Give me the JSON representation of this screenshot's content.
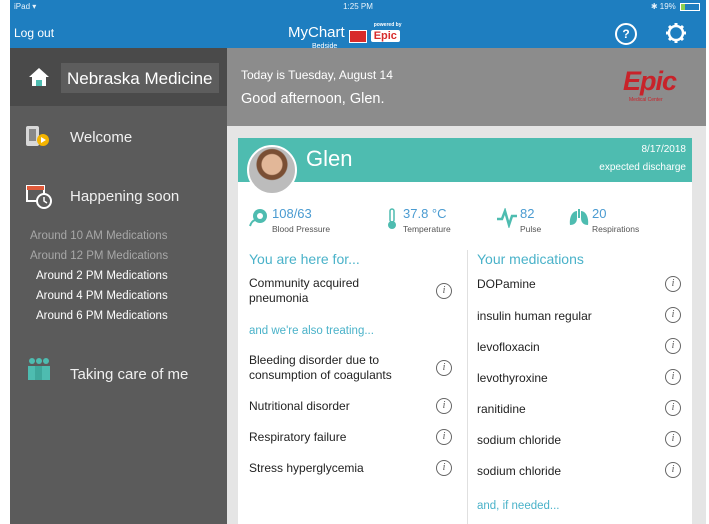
{
  "status_bar": {
    "carrier": "iPad",
    "time": "1:25 PM",
    "battery": "19%"
  },
  "header": {
    "logout_label": "Log out",
    "logo_main": "MyChart",
    "logo_sub": "Bedside",
    "logo_powered": "powered by",
    "logo_epic": "Epic",
    "help_label": "?"
  },
  "sidebar": {
    "org_name": "Nebraska Medicine",
    "welcome": "Welcome",
    "happening_soon": "Happening soon",
    "schedule": [
      {
        "time": "Around 10 AM",
        "item": "Medications"
      },
      {
        "time": "Around 12 PM",
        "item": "Medications"
      },
      {
        "time": "Around 2 PM",
        "item": "Medications"
      },
      {
        "time": "Around 4 PM",
        "item": "Medications"
      },
      {
        "time": "Around 6 PM",
        "item": "Medications"
      }
    ],
    "taking_care": "Taking care of me"
  },
  "banner": {
    "date_line": "Today is Tuesday, August 14",
    "greeting": "Good afternoon, Glen.",
    "brand": "Epic",
    "brand_sub": "Medical Center"
  },
  "patient": {
    "name": "Glen",
    "discharge_date": "8/17/2018",
    "discharge_label": "expected discharge"
  },
  "vitals": [
    {
      "value": "108/63",
      "label": "Blood Pressure"
    },
    {
      "value": "37.8 °C",
      "label": "Temperature"
    },
    {
      "value": "82",
      "label": "Pulse"
    },
    {
      "value": "20",
      "label": "Respirations"
    }
  ],
  "reasons": {
    "title": "You are here for...",
    "primary": [
      "Community acquired pneumonia"
    ],
    "also_title": "and we're also treating...",
    "also": [
      "Bleeding disorder due to consumption of coagulants",
      "Nutritional disorder",
      "Respiratory failure",
      "Stress hyperglycemia"
    ]
  },
  "medications": {
    "title": "Your medications",
    "items": [
      "DOPamine",
      "insulin human regular",
      "levofloxacin",
      "levothyroxine",
      "ranitidine",
      "sodium chloride",
      "sodium chloride"
    ],
    "more": "and, if needed..."
  },
  "info_glyph": "i",
  "colors": {
    "header": "#1e7ec0",
    "sidebar": "#5b5b5b",
    "teal": "#4ebcb0",
    "accent_text": "#4ab2c9",
    "brand_red": "#c8232a"
  }
}
